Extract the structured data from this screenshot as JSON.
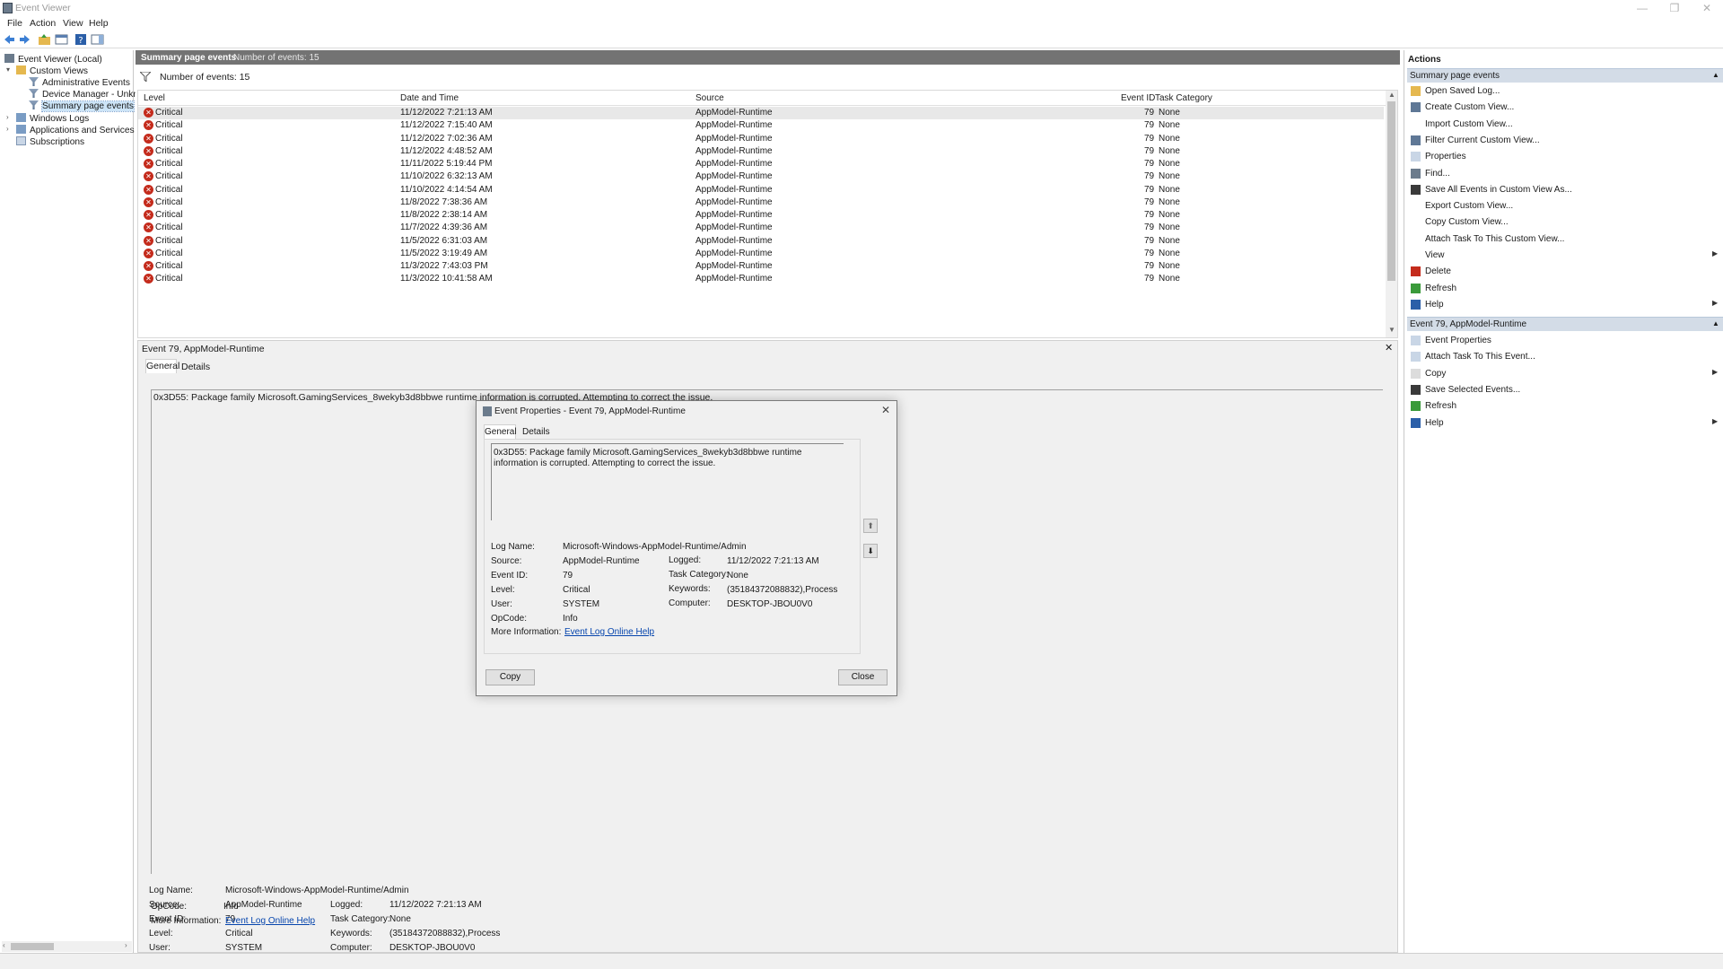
{
  "window": {
    "title": "Event Viewer",
    "controls": {
      "minimize": "—",
      "restore": "❐",
      "close": "✕"
    }
  },
  "menu": [
    "File",
    "Action",
    "View",
    "Help"
  ],
  "tree": {
    "root": "Event Viewer (Local)",
    "custom_views": "Custom Views",
    "admin_events": "Administrative Events",
    "device_manager": "Device Manager - Unkno",
    "summary_page": "Summary page events",
    "windows_logs": "Windows Logs",
    "apps_services": "Applications and Services Log",
    "subscriptions": "Subscriptions"
  },
  "summary": {
    "title": "Summary page events",
    "count_label": "Number of events: 15",
    "filter_label": "Number of events: 15"
  },
  "grid": {
    "columns": [
      "Level",
      "Date and Time",
      "Source",
      "Event ID",
      "Task Category"
    ],
    "rows": [
      {
        "level": "Critical",
        "date": "11/12/2022 7:21:13 AM",
        "source": "AppModel-Runtime",
        "id": "79",
        "task": "None"
      },
      {
        "level": "Critical",
        "date": "11/12/2022 7:15:40 AM",
        "source": "AppModel-Runtime",
        "id": "79",
        "task": "None"
      },
      {
        "level": "Critical",
        "date": "11/12/2022 7:02:36 AM",
        "source": "AppModel-Runtime",
        "id": "79",
        "task": "None"
      },
      {
        "level": "Critical",
        "date": "11/12/2022 4:48:52 AM",
        "source": "AppModel-Runtime",
        "id": "79",
        "task": "None"
      },
      {
        "level": "Critical",
        "date": "11/11/2022 5:19:44 PM",
        "source": "AppModel-Runtime",
        "id": "79",
        "task": "None"
      },
      {
        "level": "Critical",
        "date": "11/10/2022 6:32:13 AM",
        "source": "AppModel-Runtime",
        "id": "79",
        "task": "None"
      },
      {
        "level": "Critical",
        "date": "11/10/2022 4:14:54 AM",
        "source": "AppModel-Runtime",
        "id": "79",
        "task": "None"
      },
      {
        "level": "Critical",
        "date": "11/8/2022 7:38:36 AM",
        "source": "AppModel-Runtime",
        "id": "79",
        "task": "None"
      },
      {
        "level": "Critical",
        "date": "11/8/2022 2:38:14 AM",
        "source": "AppModel-Runtime",
        "id": "79",
        "task": "None"
      },
      {
        "level": "Critical",
        "date": "11/7/2022 4:39:36 AM",
        "source": "AppModel-Runtime",
        "id": "79",
        "task": "None"
      },
      {
        "level": "Critical",
        "date": "11/5/2022 6:31:03 AM",
        "source": "AppModel-Runtime",
        "id": "79",
        "task": "None"
      },
      {
        "level": "Critical",
        "date": "11/5/2022 3:19:49 AM",
        "source": "AppModel-Runtime",
        "id": "79",
        "task": "None"
      },
      {
        "level": "Critical",
        "date": "11/3/2022 7:43:03 PM",
        "source": "AppModel-Runtime",
        "id": "79",
        "task": "None"
      },
      {
        "level": "Critical",
        "date": "11/3/2022 10:41:58 AM",
        "source": "AppModel-Runtime",
        "id": "79",
        "task": "None"
      }
    ]
  },
  "detail": {
    "title": "Event 79, AppModel-Runtime",
    "tab_general": "General",
    "tab_details": "Details",
    "message": "0x3D55: Package family Microsoft.GamingServices_8wekyb3d8bbwe runtime information is corrupted. Attempting to correct the issue.",
    "log_name_label": "Log Name:",
    "log_name": "Microsoft-Windows-AppModel-Runtime/Admin",
    "source_label": "Source:",
    "source": "AppModel-Runtime",
    "logged_label": "Logged:",
    "logged": "11/12/2022 7:21:13 AM",
    "event_id_label": "Event ID:",
    "event_id": "79",
    "task_label": "Task Category:",
    "task": "None",
    "level_label": "Level:",
    "level": "Critical",
    "keywords_label": "Keywords:",
    "keywords": "(35184372088832),Process",
    "user_label": "User:",
    "user": "SYSTEM",
    "computer_label": "Computer:",
    "computer": "DESKTOP-JBOU0V0",
    "opcode_label": "OpCode:",
    "opcode": "Info",
    "more_label": "More Information:",
    "more_link": "Event Log Online Help"
  },
  "dialog": {
    "title": "Event Properties - Event 79, AppModel-Runtime",
    "tab_general": "General",
    "tab_details": "Details",
    "message": "0x3D55: Package family Microsoft.GamingServices_8wekyb3d8bbwe runtime information is corrupted. Attempting to correct the issue.",
    "copy_button": "Copy",
    "close_button": "Close"
  },
  "actions": {
    "title": "Actions",
    "section1": "Summary page events",
    "items1": [
      "Open Saved Log...",
      "Create Custom View...",
      "Import Custom View...",
      "Filter Current Custom View...",
      "Properties",
      "Find...",
      "Save All Events in Custom View As...",
      "Export Custom View...",
      "Copy Custom View...",
      "Attach Task To This Custom View...",
      "View",
      "Delete",
      "Refresh",
      "Help"
    ],
    "section2": "Event 79, AppModel-Runtime",
    "items2": [
      "Event Properties",
      "Attach Task To This Event...",
      "Copy",
      "Save Selected Events...",
      "Refresh",
      "Help"
    ]
  },
  "colors": {
    "accent": "#0645ad",
    "critical": "#c42b1c",
    "header_gray": "#737373",
    "action_header": "#d3dce7"
  }
}
